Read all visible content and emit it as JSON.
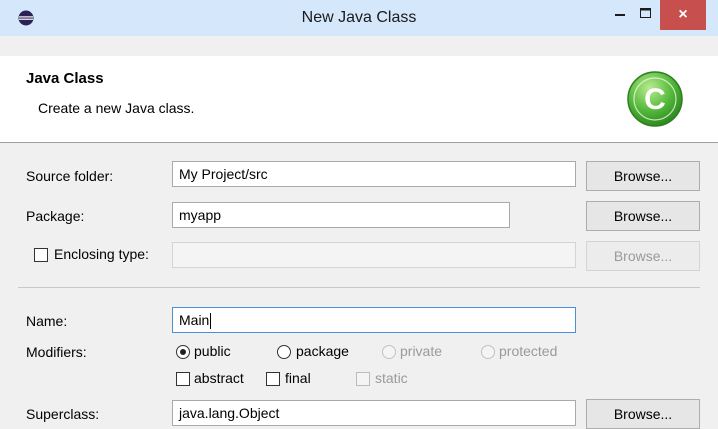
{
  "window": {
    "title": "New Java Class",
    "minimize_icon": "minimize-icon",
    "maximize_icon": "maximize-icon",
    "close_icon": "close-icon",
    "close_glyph": "×"
  },
  "header": {
    "title": "Java Class",
    "description": "Create a new Java class.",
    "icon": "java-class-icon",
    "icon_letter": "C"
  },
  "form": {
    "source_folder": {
      "label": "Source folder:",
      "value": "My Project/src",
      "button": "Browse..."
    },
    "package": {
      "label": "Package:",
      "value": "myapp",
      "button": "Browse..."
    },
    "enclosing_type": {
      "label": "Enclosing type:",
      "value": "",
      "button": "Browse...",
      "checked": false
    },
    "name": {
      "label": "Name:",
      "value": "Main"
    },
    "modifiers": {
      "label": "Modifiers:",
      "access": [
        {
          "label": "public",
          "selected": true,
          "enabled": true
        },
        {
          "label": "package",
          "selected": false,
          "enabled": true
        },
        {
          "label": "private",
          "selected": false,
          "enabled": false
        },
        {
          "label": "protected",
          "selected": false,
          "enabled": false
        }
      ],
      "flags": [
        {
          "label": "abstract",
          "checked": false,
          "enabled": true
        },
        {
          "label": "final",
          "checked": false,
          "enabled": true
        },
        {
          "label": "static",
          "checked": false,
          "enabled": false
        }
      ]
    },
    "superclass": {
      "label": "Superclass:",
      "value": "java.lang.Object",
      "button": "Browse..."
    }
  },
  "colors": {
    "titlebar": "#d4e7fb",
    "close_button": "#c7504f",
    "icon_green": "#52b83a"
  }
}
